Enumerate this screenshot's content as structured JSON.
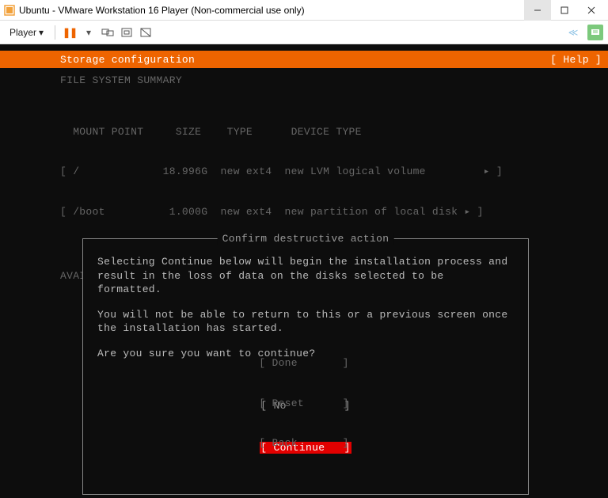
{
  "window": {
    "title": "Ubuntu - VMware Workstation 16 Player (Non-commercial use only)"
  },
  "toolbar": {
    "player_label": "Player"
  },
  "installer": {
    "header_title": "Storage configuration",
    "help_label": "[ Help ]",
    "section_fs_summary": "FILE SYSTEM SUMMARY",
    "fs_header": "  MOUNT POINT     SIZE    TYPE      DEVICE TYPE",
    "fs_row1": "[ /             18.996G  new ext4  new LVM logical volume         ▸ ]",
    "fs_row2": "[ /boot          1.000G  new ext4  new partition of local disk ▸ ]",
    "section_avail": "AVAILABLE DEVICES"
  },
  "dialog": {
    "title": "Confirm destructive action",
    "p1": "Selecting Continue below will begin the installation process and result in the loss of data on the disks selected to be formatted.",
    "p2": "You will not be able to return to this or a previous screen once the installation has started.",
    "p3": "Are you sure you want to continue?",
    "opt_no": "[ No         ]",
    "opt_continue": "[ Continue   ]"
  },
  "bottom": {
    "done": "[ Done       ]",
    "reset": "[ Reset      ]",
    "back": "[ Back       ]"
  }
}
